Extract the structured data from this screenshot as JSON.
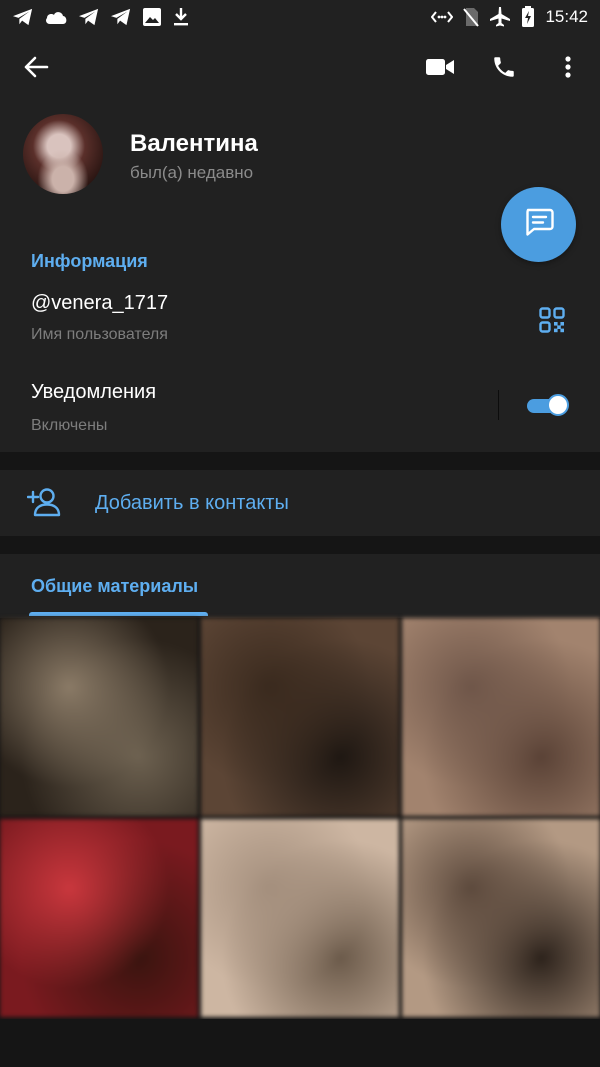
{
  "status_bar": {
    "time": "15:42",
    "left_icons": [
      "telegram-icon",
      "cloud-icon",
      "telegram-icon",
      "telegram-icon",
      "image-icon",
      "download-icon"
    ],
    "right_icons": [
      "nfc-data-icon",
      "no-sim-icon",
      "airplane-icon",
      "battery-charging-icon"
    ]
  },
  "toolbar": {
    "back_icon": "arrow-back-icon",
    "video_icon": "video-call-icon",
    "call_icon": "phone-icon",
    "more_icon": "more-vertical-icon"
  },
  "profile": {
    "name": "Валентина",
    "status": "был(а) недавно"
  },
  "info": {
    "section_title": "Информация",
    "username": "@venera_1717",
    "username_label": "Имя пользователя",
    "notifications_title": "Уведомления",
    "notifications_value": "Включены",
    "notifications_enabled": true
  },
  "add_contact": {
    "label": "Добавить в контакты"
  },
  "shared_media": {
    "tab_label": "Общие материалы",
    "thumbnails": [
      {
        "colors": [
          "#8a7a66",
          "#2b231b",
          "#6d6150"
        ]
      },
      {
        "colors": [
          "#3a2a1e",
          "#5c4535",
          "#1e1712"
        ]
      },
      {
        "colors": [
          "#6f5649",
          "#a2836e",
          "#5a4236"
        ]
      },
      {
        "colors": [
          "#c9373d",
          "#7a1a1f",
          "#3a140f"
        ]
      },
      {
        "colors": [
          "#a48f7d",
          "#cdb6a2",
          "#6b5a4a"
        ]
      },
      {
        "colors": [
          "#5d4a3d",
          "#b39983",
          "#2c221b"
        ]
      }
    ]
  },
  "colors": {
    "accent": "#4b9de0",
    "link": "#5eaef0",
    "surface": "#212121",
    "background": "#151515"
  }
}
